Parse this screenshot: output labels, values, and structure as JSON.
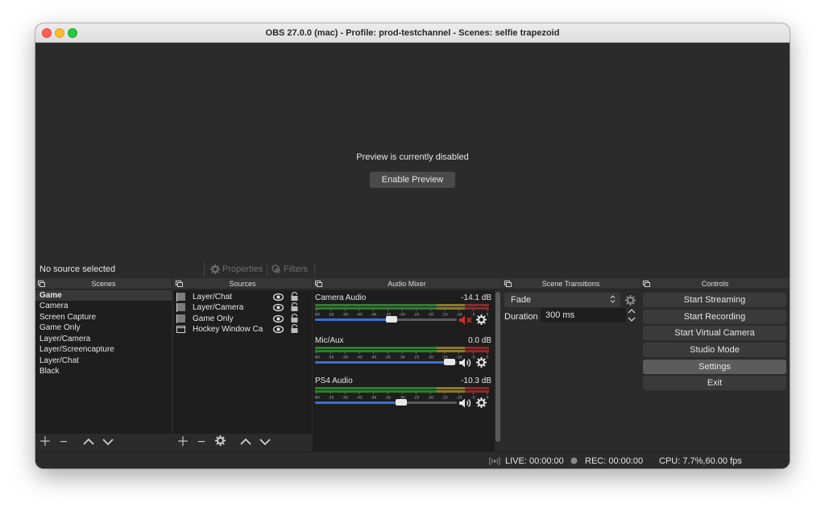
{
  "window": {
    "title": "OBS 27.0.0 (mac) - Profile: prod-testchannel - Scenes: selfie trapezoid"
  },
  "preview": {
    "message": "Preview is currently disabled",
    "enable_label": "Enable Preview"
  },
  "context": {
    "no_source": "No source selected",
    "properties_label": "Properties",
    "filters_label": "Filters"
  },
  "scenes": {
    "title": "Scenes",
    "items": [
      "Game",
      "Camera",
      "Screen Capture",
      "Game Only",
      "Layer/Camera",
      "Layer/Screencapture",
      "Layer/Chat",
      "Black"
    ],
    "selected": "Game"
  },
  "sources": {
    "title": "Sources",
    "items": [
      {
        "label": "Layer/Chat",
        "icon": "group-icon"
      },
      {
        "label": "Layer/Camera",
        "icon": "group-icon"
      },
      {
        "label": "Game Only",
        "icon": "group-icon"
      },
      {
        "label": "Hockey Window Ca",
        "icon": "window-capture-icon"
      }
    ]
  },
  "mixer": {
    "title": "Audio Mixer",
    "scale_labels": [
      "-60",
      "-55",
      "-50",
      "-45",
      "-40",
      "-35",
      "-30",
      "-25",
      "-20",
      "-15",
      "-10",
      "-5",
      "0"
    ],
    "channels": [
      {
        "name": "Camera Audio",
        "db": "-14.1 dB",
        "level": 0.54,
        "muted": true
      },
      {
        "name": "Mic/Aux",
        "db": "0.0 dB",
        "level": 0.95,
        "muted": false
      },
      {
        "name": "PS4 Audio",
        "db": "-10.3 dB",
        "level": 0.61,
        "muted": false
      }
    ]
  },
  "transitions": {
    "title": "Scene Transitions",
    "selected": "Fade",
    "duration_label": "Duration",
    "duration_value": "300 ms"
  },
  "controls": {
    "title": "Controls",
    "buttons": [
      "Start Streaming",
      "Start Recording",
      "Start Virtual Camera",
      "Studio Mode",
      "Settings",
      "Exit"
    ],
    "active": "Settings"
  },
  "status": {
    "live": "LIVE: 00:00:00",
    "rec": "REC: 00:00:00",
    "cpu": "CPU: 7.7%,60.00 fps"
  },
  "colors": {
    "accent": "#3c6fd1",
    "muted": "#d0302a",
    "bg": "#2b2b2b",
    "list_bg": "#1e1e1e"
  }
}
